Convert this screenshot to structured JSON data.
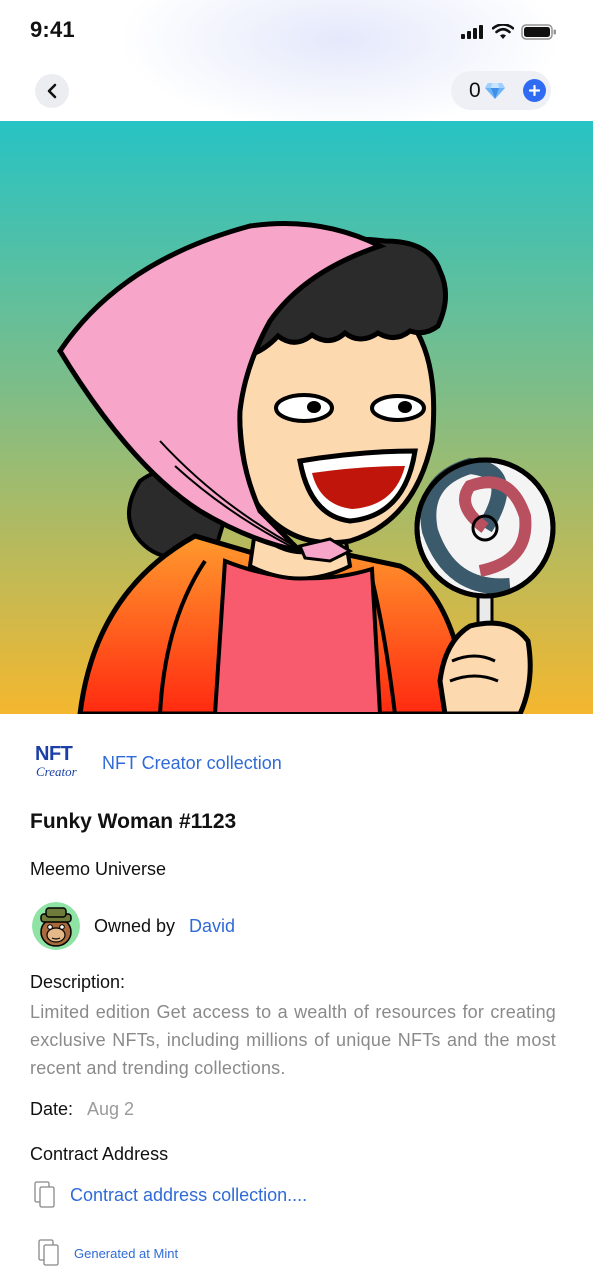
{
  "status_bar": {
    "time": "9:41"
  },
  "wallet": {
    "count": "0"
  },
  "collection": {
    "logo_main": "NFT",
    "logo_sub": "Creator",
    "link": "NFT Creator collection"
  },
  "nft": {
    "title": "Funky Woman #1123",
    "universe": "Meemo Universe"
  },
  "owner": {
    "label": "Owned by",
    "name": "David"
  },
  "description": {
    "label": "Description:",
    "text": "Limited edition Get access to a wealth of resources for creating exclusive NFTs, including millions of unique NFTs and the most recent and trending collections."
  },
  "date": {
    "label": "Date:",
    "value": "Aug 2"
  },
  "contract": {
    "label": "Contract Address",
    "link": "Contract address collection...."
  },
  "mint": {
    "label": "Generated at Mint"
  },
  "colors": {
    "accent": "#2f6bf3",
    "link": "#2f6bd8",
    "muted": "#8a8a8a"
  }
}
